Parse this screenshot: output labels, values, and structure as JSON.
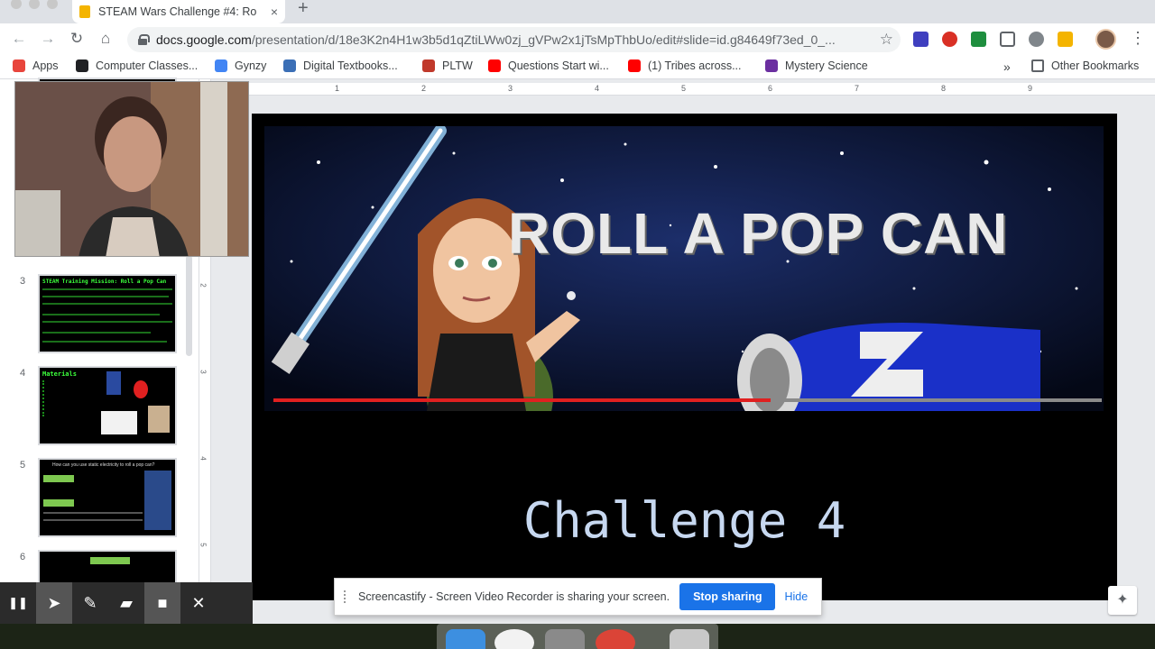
{
  "browser": {
    "tab_title": "STEAM Wars Challenge #4: Ro",
    "tab_close": "×",
    "new_tab": "+",
    "url_host": "docs.google.com",
    "url_path": "/presentation/d/18e3K2n4H1w3b5d1qZtiLWw0zj_gVPw2x1jTsMpThbUo/edit#slide=id.g84649f73ed_0_..."
  },
  "nav": {
    "back": "←",
    "forward": "→",
    "reload": "↻",
    "home": "⌂",
    "star": "☆",
    "menu": "⋮"
  },
  "bookmarks": [
    {
      "label": "Apps",
      "icon": "apps-grid-icon",
      "color": "#e8453c"
    },
    {
      "label": "Computer Classes...",
      "icon": "globe-icon",
      "color": "#202124"
    },
    {
      "label": "Gynzy",
      "icon": "gynzy-icon",
      "color": "#4285f4"
    },
    {
      "label": "Digital Textbooks...",
      "icon": "globe-icon",
      "color": "#3b6fb6"
    },
    {
      "label": "PLTW",
      "icon": "atom-icon",
      "color": "#c0392b"
    },
    {
      "label": "Questions Start wi...",
      "icon": "youtube-icon",
      "color": "#ff0000"
    },
    {
      "label": "(1) Tribes across...",
      "icon": "youtube-icon",
      "color": "#ff0000"
    },
    {
      "label": "Mystery Science",
      "icon": "mystery-science-icon",
      "color": "#6b2fa0"
    }
  ],
  "bookmarks_more": "»",
  "other_bookmarks": "Other Bookmarks",
  "filmstrip": {
    "slides": [
      {
        "number": "3",
        "title": "STEAM Training Mission: Roll a Pop Can"
      },
      {
        "number": "4",
        "title": "Materials"
      },
      {
        "number": "5",
        "title": "How can you use static electricity to roll a pop can?"
      },
      {
        "number": "6",
        "title": ""
      }
    ]
  },
  "ruler": {
    "horizontal": [
      "1",
      "2",
      "3",
      "4",
      "5",
      "6",
      "7",
      "8",
      "9"
    ],
    "vertical": [
      "2",
      "3",
      "4",
      "5"
    ]
  },
  "slide": {
    "banner_title": "ROLL A POP CAN",
    "video_progress": 0.6,
    "challenge_text": "Challenge 4"
  },
  "recorder": {
    "pause": "❚❚",
    "pointer": "➤",
    "pen": "✎",
    "eraser": "▰",
    "camera": "■",
    "close": "✕"
  },
  "share_banner": {
    "message": "Screencastify - Screen Video Recorder is sharing your screen.",
    "stop_label": "Stop sharing",
    "hide_label": "Hide"
  },
  "colors": {
    "accent": "#1a73e8",
    "progress": "#e02020",
    "challenge_text": "#c7d8f0"
  }
}
